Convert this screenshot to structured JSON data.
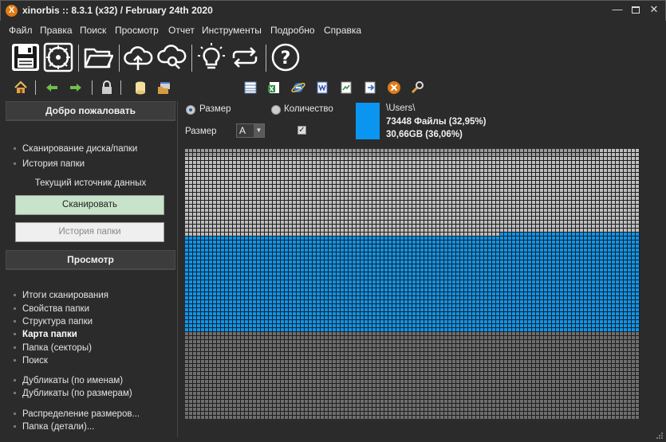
{
  "window": {
    "title": "xinorbis :: 8.3.1 (x32) / February 24th 2020",
    "app_icon_letter": "X"
  },
  "menu": [
    "Файл",
    "Правка",
    "Поиск",
    "Просмотр",
    "Отчет",
    "Инструменты",
    "Подробно",
    "Справка"
  ],
  "toolbar_main": [
    "save-icon",
    "disk-scan-icon",
    "open-folder-icon",
    "cloud-upload-icon",
    "cloud-search-icon",
    "lightbulb-icon",
    "sync-arrows-icon",
    "help-icon"
  ],
  "toolbar_small": [
    "home-icon",
    "back-arrow-icon",
    "forward-arrow-icon",
    "lock-icon",
    "database-icon",
    "folder-window-icon",
    "table-icon",
    "sheet-icon",
    "ie-icon",
    "doc-icon",
    "page-icon",
    "export-icon",
    "xinorbis-icon",
    "wrench-icon"
  ],
  "left_panel": {
    "welcome_header": "Добро пожаловать",
    "welcome_items": [
      "Сканирование диска/папки",
      "История папки"
    ],
    "datasource_label": "Текущий источник данных",
    "scan_button": "Сканировать",
    "history_button": "История папки",
    "view_header": "Просмотр",
    "view_items": [
      {
        "label": "Итоги сканирования",
        "bold": false
      },
      {
        "label": "Свойства папки",
        "bold": false
      },
      {
        "label": "Структура папки",
        "bold": false
      },
      {
        "label": "Карта папки",
        "bold": true
      },
      {
        "label": "Папка (секторы)",
        "bold": false
      },
      {
        "label": "Поиск",
        "bold": false
      },
      {
        "label": "Дубликаты (по именам)",
        "bold": false
      },
      {
        "label": "Дубликаты (по размерам)",
        "bold": false
      },
      {
        "label": "Распределение размеров...",
        "bold": false
      },
      {
        "label": "Папка (детали)...",
        "bold": false
      }
    ]
  },
  "map_panel": {
    "radio_size": "Размер",
    "radio_count": "Количество",
    "selected_mode": "Размер",
    "size_label": "Размер",
    "size_select_value": "A",
    "checkbox_checked": true,
    "selected_path": "\\Users\\",
    "selected_files": "73448 Файлы (32,95%)",
    "selected_size": "30,66GB  (36,06%)",
    "selected_color": "#0a96f0",
    "colors": {
      "background": "#2b2b2b",
      "cell_light": "#bdbdbd",
      "cell_mid": "#9a9a9a",
      "cell_dark": "#6e6e6e",
      "cell_blue": "#0a96f0"
    }
  }
}
